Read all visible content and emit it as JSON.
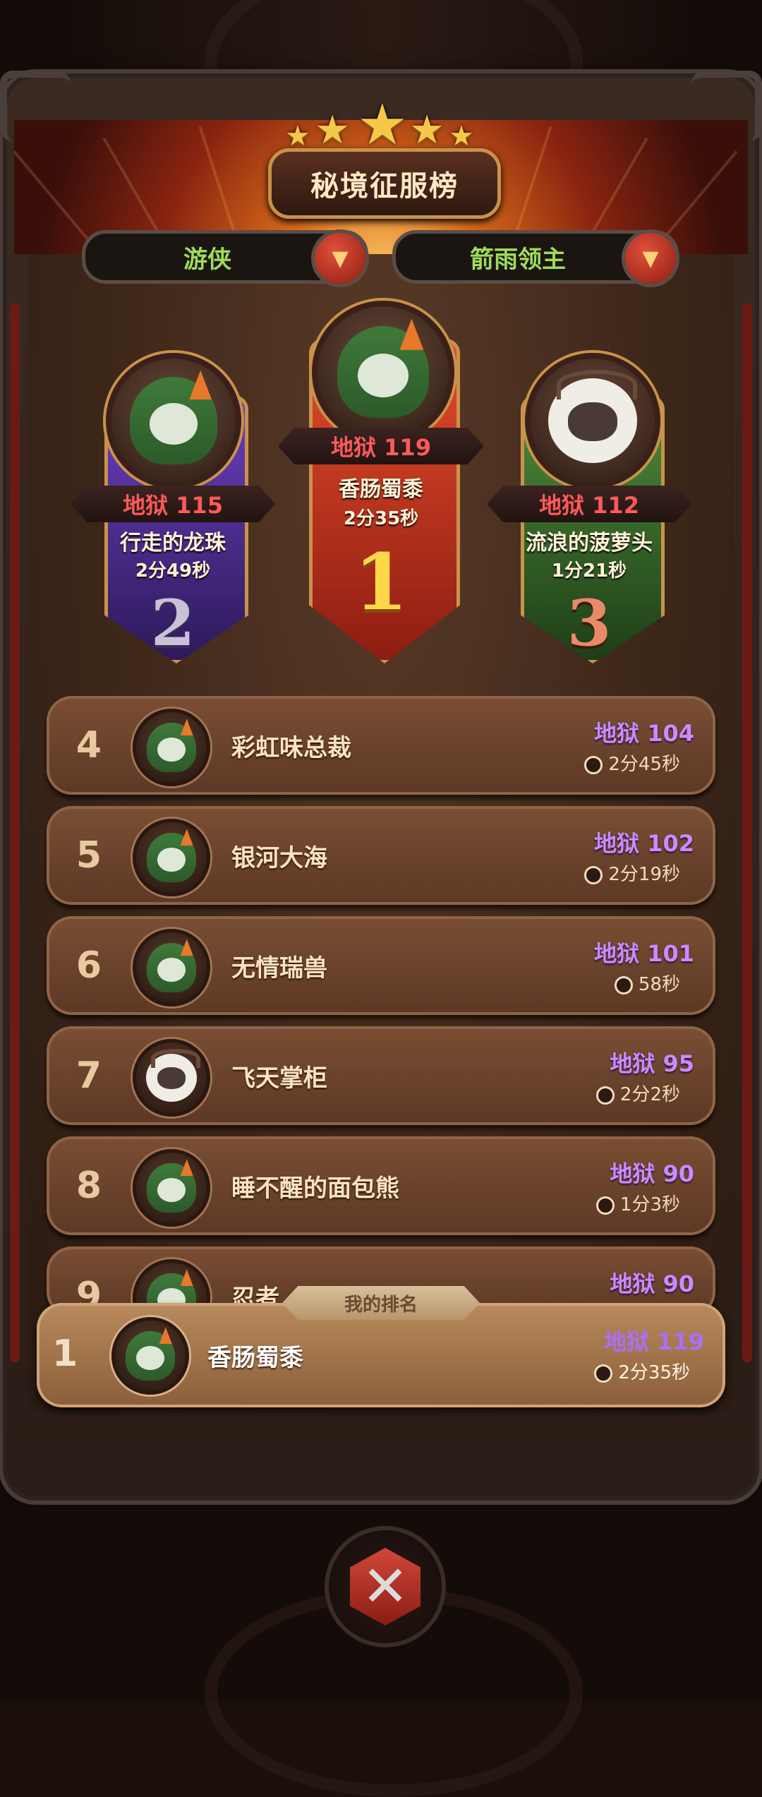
{
  "header": {
    "title": "秘境征服榜",
    "class_filter": "游侠",
    "dungeon_filter": "箭雨领主"
  },
  "podium": [
    {
      "rank": "1",
      "difficulty": "地狱 119",
      "name": "香肠蜀黍",
      "time": "2分35秒"
    },
    {
      "rank": "2",
      "difficulty": "地狱 115",
      "name": "行走的龙珠",
      "time": "2分49秒"
    },
    {
      "rank": "3",
      "difficulty": "地狱 112",
      "name": "流浪的菠萝头",
      "time": "1分21秒"
    }
  ],
  "list": [
    {
      "rank": "4",
      "name": "彩虹味总裁",
      "difficulty": "地狱 104",
      "time": "2分45秒"
    },
    {
      "rank": "5",
      "name": "银河大海",
      "difficulty": "地狱 102",
      "time": "2分19秒"
    },
    {
      "rank": "6",
      "name": "无情瑞兽",
      "difficulty": "地狱 101",
      "time": "58秒"
    },
    {
      "rank": "7",
      "name": "飞天掌柜",
      "difficulty": "地狱 95",
      "time": "2分2秒"
    },
    {
      "rank": "8",
      "name": "睡不醒的面包熊",
      "difficulty": "地狱 90",
      "time": "1分3秒"
    },
    {
      "rank": "9",
      "name": "忍者",
      "difficulty": "地狱 90",
      "time": ""
    }
  ],
  "my_rank": {
    "tab_label": "我的排名",
    "rank": "1",
    "name": "香肠蜀黍",
    "difficulty": "地狱 119",
    "time": "2分35秒"
  },
  "colors": {
    "accent_red": "#ff5a5a",
    "difficulty_purple": "#c98bff",
    "filter_green": "#9fdc5a"
  }
}
